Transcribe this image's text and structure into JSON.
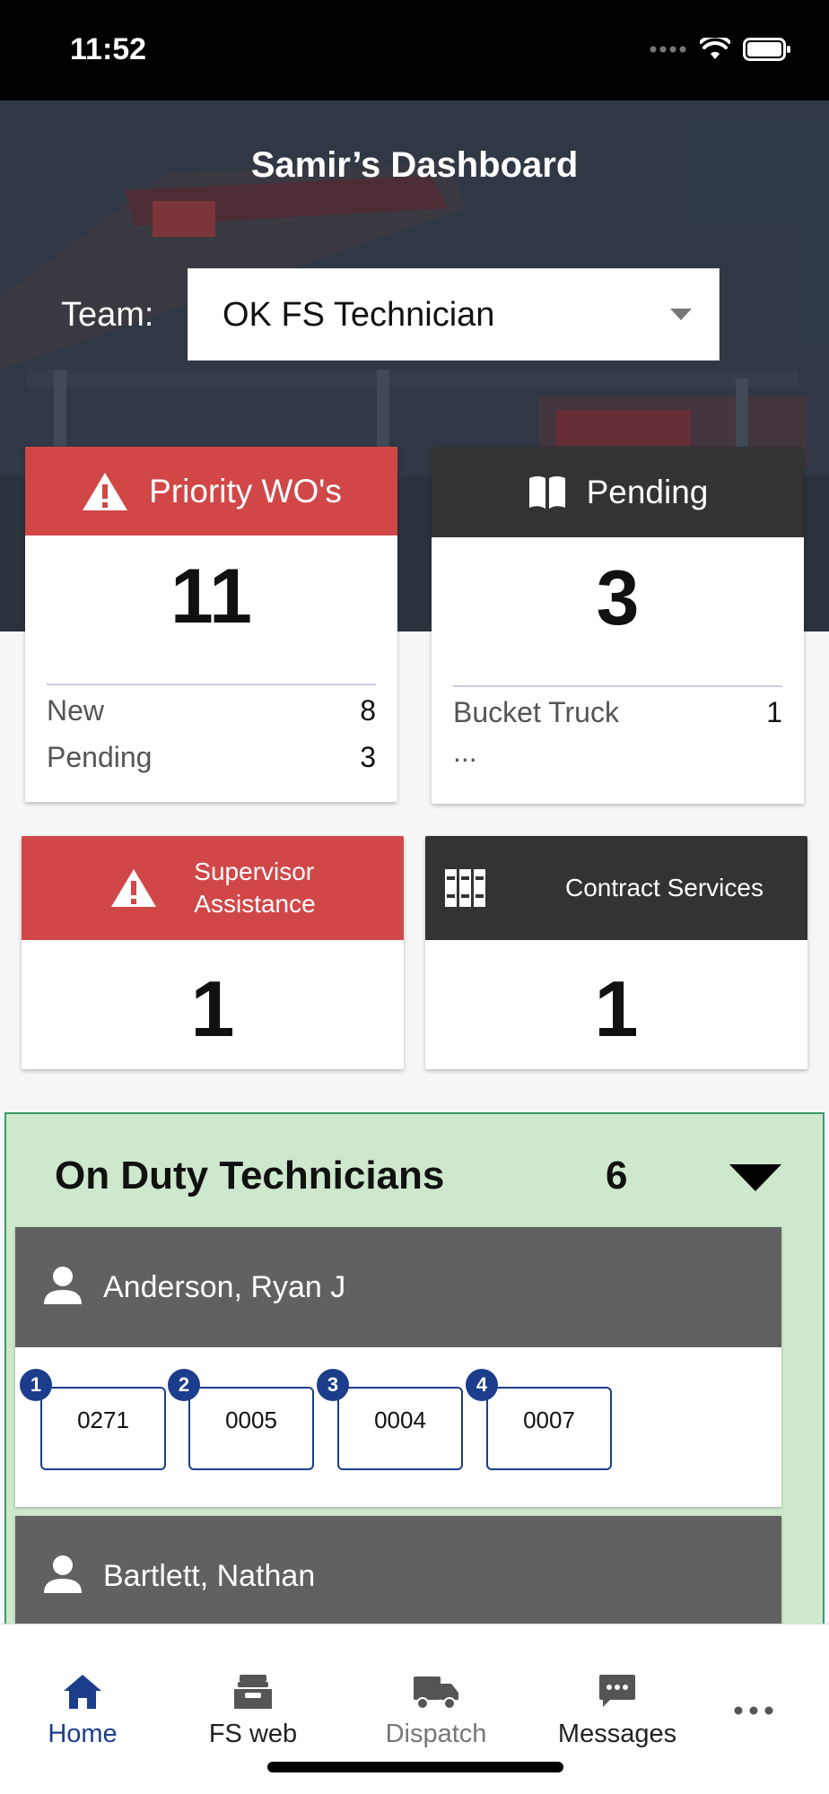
{
  "status_bar": {
    "time": "11:52"
  },
  "header": {
    "title": "Samir’s Dashboard",
    "team_label": "Team:",
    "team_value": "OK FS Technician"
  },
  "cards": {
    "priority": {
      "title": "Priority WO's",
      "count": "11",
      "rows": [
        {
          "label": "New",
          "value": "8"
        },
        {
          "label": "Pending",
          "value": "3"
        }
      ],
      "color": "#d14748"
    },
    "pending": {
      "title": "Pending",
      "count": "3",
      "rows": [
        {
          "label": "Bucket Truck",
          "value": "1"
        }
      ],
      "more": "...",
      "color": "#333333"
    },
    "supervisor": {
      "title_line1": "Supervisor",
      "title_line2": "Assistance",
      "count": "1"
    },
    "contract": {
      "title": "Contract Services",
      "count": "1"
    }
  },
  "technicians": {
    "title": "On Duty Technicians",
    "count": "6",
    "list": [
      {
        "name": "Anderson, Ryan J",
        "work_orders": [
          {
            "badge": "1",
            "number": "0271"
          },
          {
            "badge": "2",
            "number": "0005"
          },
          {
            "badge": "3",
            "number": "0004"
          },
          {
            "badge": "4",
            "number": "0007"
          }
        ]
      },
      {
        "name": "Bartlett, Nathan"
      }
    ]
  },
  "tabbar": {
    "tabs": [
      {
        "label": "Home",
        "icon": "home-icon",
        "active": true
      },
      {
        "label": "FS web",
        "icon": "inbox-tray-icon"
      },
      {
        "label": "Dispatch",
        "icon": "truck-icon"
      },
      {
        "label": "Messages",
        "icon": "chat-bubble-icon"
      },
      {
        "label": "",
        "icon": "more-icon"
      }
    ],
    "active_color": "#1c3d8c",
    "inactive_color": "#222222"
  }
}
